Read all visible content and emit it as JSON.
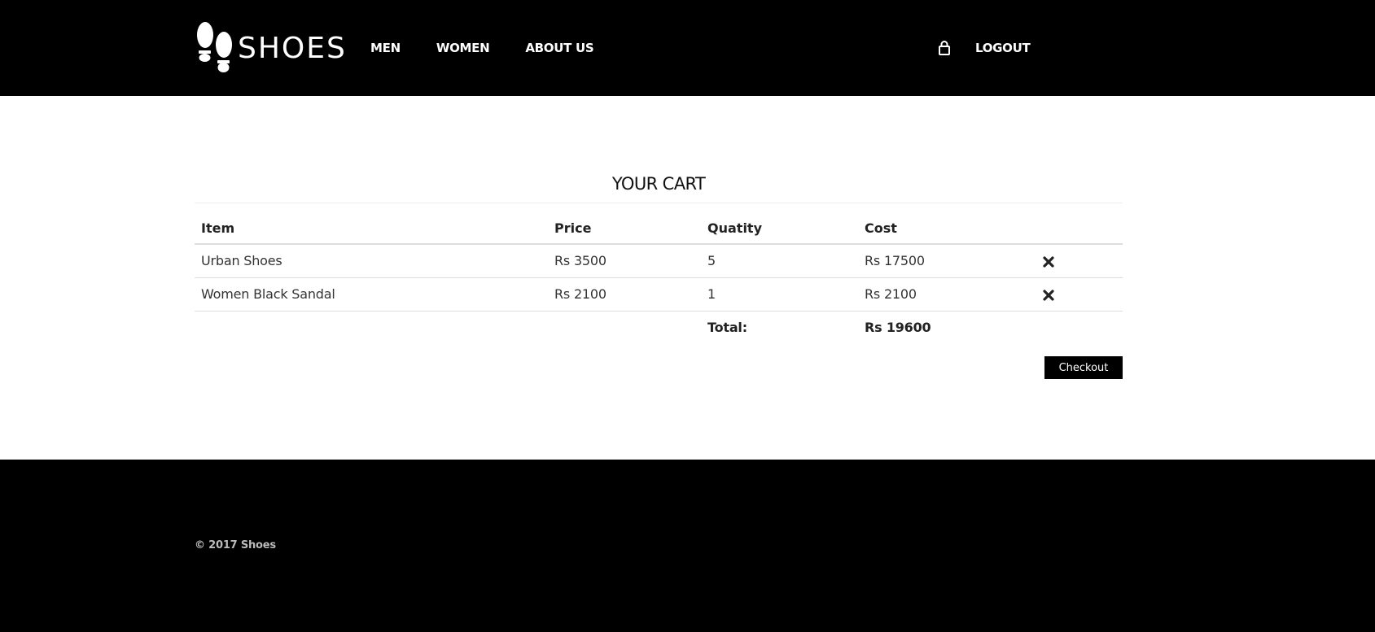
{
  "header": {
    "logo_text": "SHOES",
    "nav": [
      {
        "label": "MEN"
      },
      {
        "label": "WOMEN"
      },
      {
        "label": "ABOUT US"
      }
    ],
    "logout_label": "LOGOUT"
  },
  "cart": {
    "title": "YOUR CART",
    "columns": [
      "Item",
      "Price",
      "Quatity",
      "Cost"
    ],
    "rows": [
      {
        "item": "Urban Shoes",
        "price": "Rs 3500",
        "quantity": "5",
        "cost": "Rs 17500"
      },
      {
        "item": "Women Black Sandal",
        "price": "Rs 2100",
        "quantity": "1",
        "cost": "Rs 2100"
      }
    ],
    "total_label": "Total:",
    "total_value": "Rs 19600",
    "checkout_label": "Checkout"
  },
  "footer": {
    "copyright": "© 2017 Shoes"
  },
  "icons": {
    "logo": "footprints-icon",
    "account": "lock-icon",
    "remove": "close-icon"
  },
  "colors": {
    "header_bg": "#000000",
    "footer_bg": "#000000",
    "button_bg": "#000000"
  }
}
